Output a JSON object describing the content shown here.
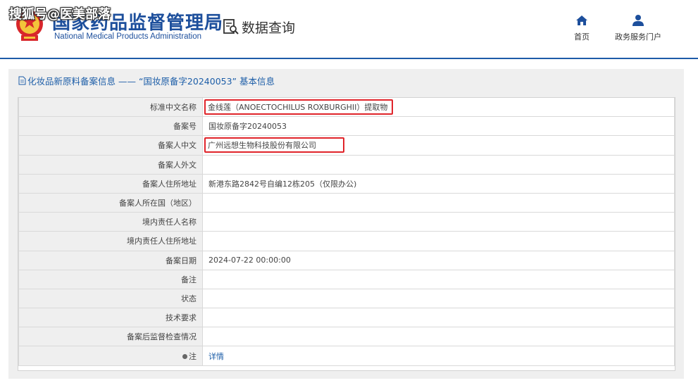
{
  "header": {
    "agency_cn": "国家药品监督管理局",
    "agency_en": "National Medical Products Administration",
    "watermark": "搜狐号@医美部落",
    "page_name": "数据查询",
    "nav": [
      {
        "label": "首页",
        "icon": "home-icon"
      },
      {
        "label": "政务服务门户",
        "icon": "user-icon"
      }
    ]
  },
  "panel": {
    "title": "化妆品新原料备案信息 —— “国妆原备字20240053” 基本信息",
    "rows": [
      {
        "label": "标准中文名称",
        "value": "金线莲（ANOECTOCHILUS ROXBURGHII）提取物",
        "highlighted": true
      },
      {
        "label": "备案号",
        "value": "国妆原备字20240053"
      },
      {
        "label": "备案人中文",
        "value": "广州远想生物科技股份有限公司",
        "highlighted": true
      },
      {
        "label": "备案人外文",
        "value": ""
      },
      {
        "label": "备案人住所地址",
        "value": "新港东路2842号自编12栋205（仅限办公)"
      },
      {
        "label": "备案人所在国（地区）",
        "value": ""
      },
      {
        "label": "境内责任人名称",
        "value": ""
      },
      {
        "label": "境内责任人住所地址",
        "value": ""
      },
      {
        "label": "备案日期",
        "value": "2024-07-22 00:00:00"
      },
      {
        "label": "备注",
        "value": ""
      },
      {
        "label": "状态",
        "value": ""
      },
      {
        "label": "技术要求",
        "value": ""
      },
      {
        "label": "备案后监督检查情况",
        "value": ""
      },
      {
        "label": "注",
        "value": "详情",
        "is_link": true
      }
    ]
  },
  "colors": {
    "brand_blue": "#1d4f9c",
    "link_blue": "#1d5ea8",
    "highlight_red": "#e0242a",
    "label_bg": "#efefef"
  }
}
